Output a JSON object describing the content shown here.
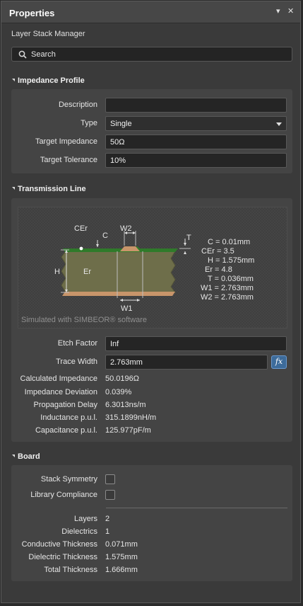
{
  "window": {
    "title": "Properties",
    "pin_glyph": "▾",
    "close_glyph": "✕"
  },
  "subtitle": "Layer Stack Manager",
  "search": {
    "placeholder": "Search"
  },
  "impedance_profile": {
    "header": "Impedance Profile",
    "description": {
      "label": "Description",
      "value": ""
    },
    "type": {
      "label": "Type",
      "value": "Single"
    },
    "target_impedance": {
      "label": "Target Impedance",
      "value": "50Ω"
    },
    "target_tolerance": {
      "label": "Target Tolerance",
      "value": "10%"
    }
  },
  "transmission_line": {
    "header": "Transmission Line",
    "diagram": {
      "labels": {
        "cer": "CEr",
        "c": "C",
        "w2": "W2",
        "t": "T",
        "h": "H",
        "er": "Er",
        "w1": "W1"
      },
      "params": [
        "C = 0.01mm",
        "CEr = 3.5",
        "H = 1.575mm",
        "Er = 4.8",
        "T = 0.036mm",
        "W1 = 2.763mm",
        "W2 = 2.763mm"
      ],
      "credit": "Simulated with SIMBEOR® software"
    },
    "etch_factor": {
      "label": "Etch Factor",
      "value": "Inf"
    },
    "trace_width": {
      "label": "Trace Width",
      "value": "2.763mm",
      "fx": "fx"
    },
    "results": [
      {
        "label": "Calculated Impedance",
        "value": "50.0196Ω"
      },
      {
        "label": "Impedance Deviation",
        "value": "0.039%"
      },
      {
        "label": "Propagation Delay",
        "value": "6.3013ns/m"
      },
      {
        "label": "Inductance p.u.l.",
        "value": "315.1899nH/m"
      },
      {
        "label": "Capacitance p.u.l.",
        "value": "125.977pF/m"
      }
    ]
  },
  "board": {
    "header": "Board",
    "stack_symmetry": {
      "label": "Stack Symmetry",
      "checked": false
    },
    "library_compliance": {
      "label": "Library Compliance",
      "checked": false
    },
    "stats": [
      {
        "label": "Layers",
        "value": "2"
      },
      {
        "label": "Dielectrics",
        "value": "1"
      },
      {
        "label": "Conductive Thickness",
        "value": "0.071mm"
      },
      {
        "label": "Dielectric Thickness",
        "value": "1.575mm"
      },
      {
        "label": "Total Thickness",
        "value": "1.666mm"
      }
    ]
  },
  "colors": {
    "panel": "#3a3a3a",
    "section": "#444444",
    "input": "#252525",
    "accent": "#3d6b9a",
    "copper": "#c8956a",
    "dielectric": "#6e6e4a",
    "soldermask": "#2f7a2a"
  }
}
